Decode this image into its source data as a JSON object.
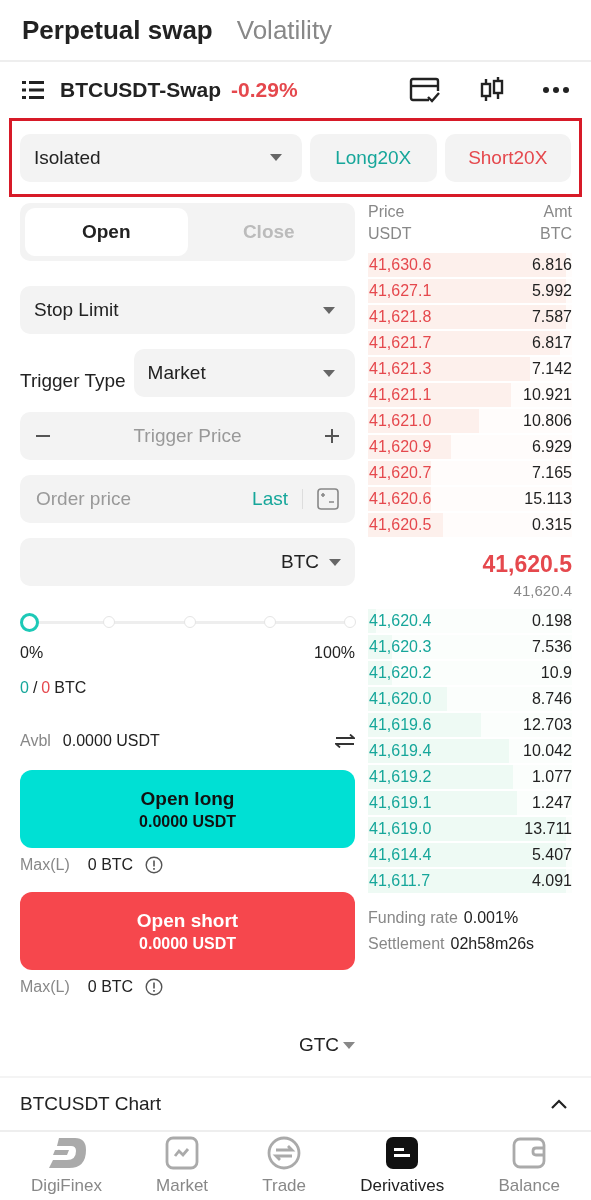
{
  "top_tabs": [
    {
      "label": "Perpetual swap",
      "selected": true
    },
    {
      "label": "Volatility",
      "selected": false
    }
  ],
  "ticker": {
    "symbol": "BTCUSDT-Swap",
    "change": "-0.29%"
  },
  "margin": {
    "mode": "Isolated",
    "leverage": [
      {
        "kind": "long",
        "label": "Long20X"
      },
      {
        "kind": "short",
        "label": "Short20X"
      }
    ]
  },
  "order_tabs": [
    {
      "label": "Open",
      "selected": true
    },
    {
      "label": "Close",
      "selected": false
    }
  ],
  "order_type": "Stop Limit",
  "trigger_type": {
    "label": "Trigger Type",
    "value": "Market"
  },
  "trigger_price": {
    "placeholder": "Trigger Price"
  },
  "order_price": {
    "placeholder": "Order price",
    "link": "Last"
  },
  "amount": {
    "unit": "BTC"
  },
  "slider": {
    "level": 0,
    "min_label": "0%",
    "max_label": "100%"
  },
  "position": {
    "long": "0",
    "separator": "/",
    "short": "0",
    "unit": "BTC"
  },
  "available": {
    "label": "Avbl",
    "value": "0.0000 USDT"
  },
  "actions": [
    {
      "kind": "long",
      "title": "Open long",
      "amount": "0.0000 USDT",
      "max_label": "Max(L)",
      "max_value": "0 BTC"
    },
    {
      "kind": "short",
      "title": "Open short",
      "amount": "0.0000 USDT",
      "max_label": "Max(L)",
      "max_value": "0 BTC"
    }
  ],
  "time_in_force": "GTC",
  "order_book": {
    "columns": [
      {
        "title": "Price",
        "unit": "USDT"
      },
      {
        "title": "Amt",
        "unit": "BTC"
      }
    ],
    "asks": [
      {
        "price": "41,630.6",
        "amount": "6.816",
        "level": 1
      },
      {
        "price": "41,627.1",
        "amount": "5.992",
        "level": 1
      },
      {
        "price": "41,621.8",
        "amount": "7.587",
        "level": 1
      },
      {
        "price": "41,621.7",
        "amount": "6.817",
        "level": 0.97
      },
      {
        "price": "41,621.3",
        "amount": "7.142",
        "level": 0.82
      },
      {
        "price": "41,621.1",
        "amount": "10.921",
        "level": 0.72
      },
      {
        "price": "41,621.0",
        "amount": "10.806",
        "level": 0.56
      },
      {
        "price": "41,620.9",
        "amount": "6.929",
        "level": 0.42
      },
      {
        "price": "41,620.7",
        "amount": "7.165",
        "level": 0.32
      },
      {
        "price": "41,620.6",
        "amount": "15.113",
        "level": 0.32
      },
      {
        "price": "41,620.5",
        "amount": "0.315",
        "level": 0.38
      }
    ],
    "last_price": "41,620.5",
    "mark_price": "41,620.4",
    "bids": [
      {
        "price": "41,620.4",
        "amount": "0.198",
        "level": 0.04
      },
      {
        "price": "41,620.3",
        "amount": "7.536",
        "level": 0.12
      },
      {
        "price": "41,620.2",
        "amount": "10.9",
        "level": 0.12
      },
      {
        "price": "41,620.0",
        "amount": "8.746",
        "level": 0.4
      },
      {
        "price": "41,619.6",
        "amount": "12.703",
        "level": 0.57
      },
      {
        "price": "41,619.4",
        "amount": "10.042",
        "level": 0.71
      },
      {
        "price": "41,619.2",
        "amount": "1.077",
        "level": 0.73
      },
      {
        "price": "41,619.1",
        "amount": "1.247",
        "level": 0.75
      },
      {
        "price": "41,619.0",
        "amount": "13.711",
        "level": 1
      },
      {
        "price": "41,614.4",
        "amount": "5.407",
        "level": 1
      },
      {
        "price": "41,611.7",
        "amount": "4.091",
        "level": 1
      }
    ],
    "funding": {
      "label": "Funding rate",
      "value": "0.001%"
    },
    "settlement": {
      "label": "Settlement",
      "value": "02h58m26s"
    }
  },
  "chart_section": {
    "title": "BTCUSDT Chart",
    "expanded": true
  },
  "bottom_nav": [
    {
      "kind": "logo",
      "label": "DigiFinex",
      "selected": false
    },
    {
      "kind": "market",
      "label": "Market",
      "selected": false
    },
    {
      "kind": "trade",
      "label": "Trade",
      "selected": false
    },
    {
      "kind": "derivatives",
      "label": "Derivatives",
      "selected": true
    },
    {
      "kind": "balance",
      "label": "Balance",
      "selected": false
    }
  ]
}
